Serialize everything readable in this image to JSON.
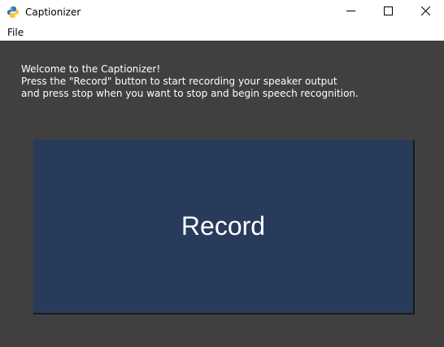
{
  "window": {
    "title": "Captionizer",
    "app_icon": "python-icon",
    "controls": {
      "minimize": "minimize-icon",
      "maximize": "maximize-icon",
      "close": "close-icon"
    }
  },
  "menubar": {
    "items": [
      {
        "label": "File"
      }
    ]
  },
  "main": {
    "intro_lines": [
      "Welcome to the Captionizer!",
      "Press the \"Record\" button to start recording your speaker output",
      "and press stop when you want to stop and begin speech recognition."
    ],
    "record_label": "Record"
  },
  "colors": {
    "background": "#404040",
    "button": "#283b5b",
    "text": "#ffffff",
    "chrome": "#ffffff"
  }
}
